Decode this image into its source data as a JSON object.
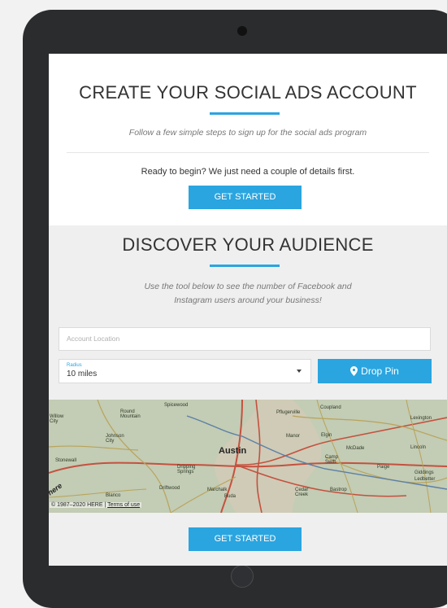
{
  "header": {
    "title": "CREATE YOUR SOCIAL ADS ACCOUNT",
    "subtitle": "Follow a few simple steps to sign up for the social ads program",
    "ready_text": "Ready to begin? We just need a couple of details first.",
    "start_button": "GET STARTED"
  },
  "audience": {
    "title": "DISCOVER YOUR AUDIENCE",
    "subtitle_line1": "Use the tool below to see the number of Facebook and",
    "subtitle_line2": "Instagram users around your business!",
    "location_placeholder": "Account Location",
    "radius_label": "Radius",
    "radius_value": "10 miles",
    "drop_pin_button": "Drop Pin",
    "drop_pin_icon": "map-pin-icon",
    "start_button": "GET STARTED"
  },
  "map": {
    "places": [
      "Spicewood",
      "Round Mountain",
      "Willow City",
      "Johnson City",
      "Stonewall",
      "Dripping Springs",
      "Driftwood",
      "Blanco",
      "Austin",
      "Pflugerville",
      "Coupland",
      "Manor",
      "Elgin",
      "McDade",
      "Camp Swift",
      "Paige",
      "Lexington",
      "Lincoln",
      "Giddings",
      "Ledbetter",
      "Marchalk",
      "Buda",
      "Cedar Creek",
      "Bastrop"
    ],
    "logo": "here",
    "copyright": "© 1987–2020 HERE |",
    "terms_link": "Terms of use"
  },
  "colors": {
    "accent": "#2aa5e0",
    "tablet_frame": "#2b2c2e",
    "section_bg": "#efeff0"
  }
}
